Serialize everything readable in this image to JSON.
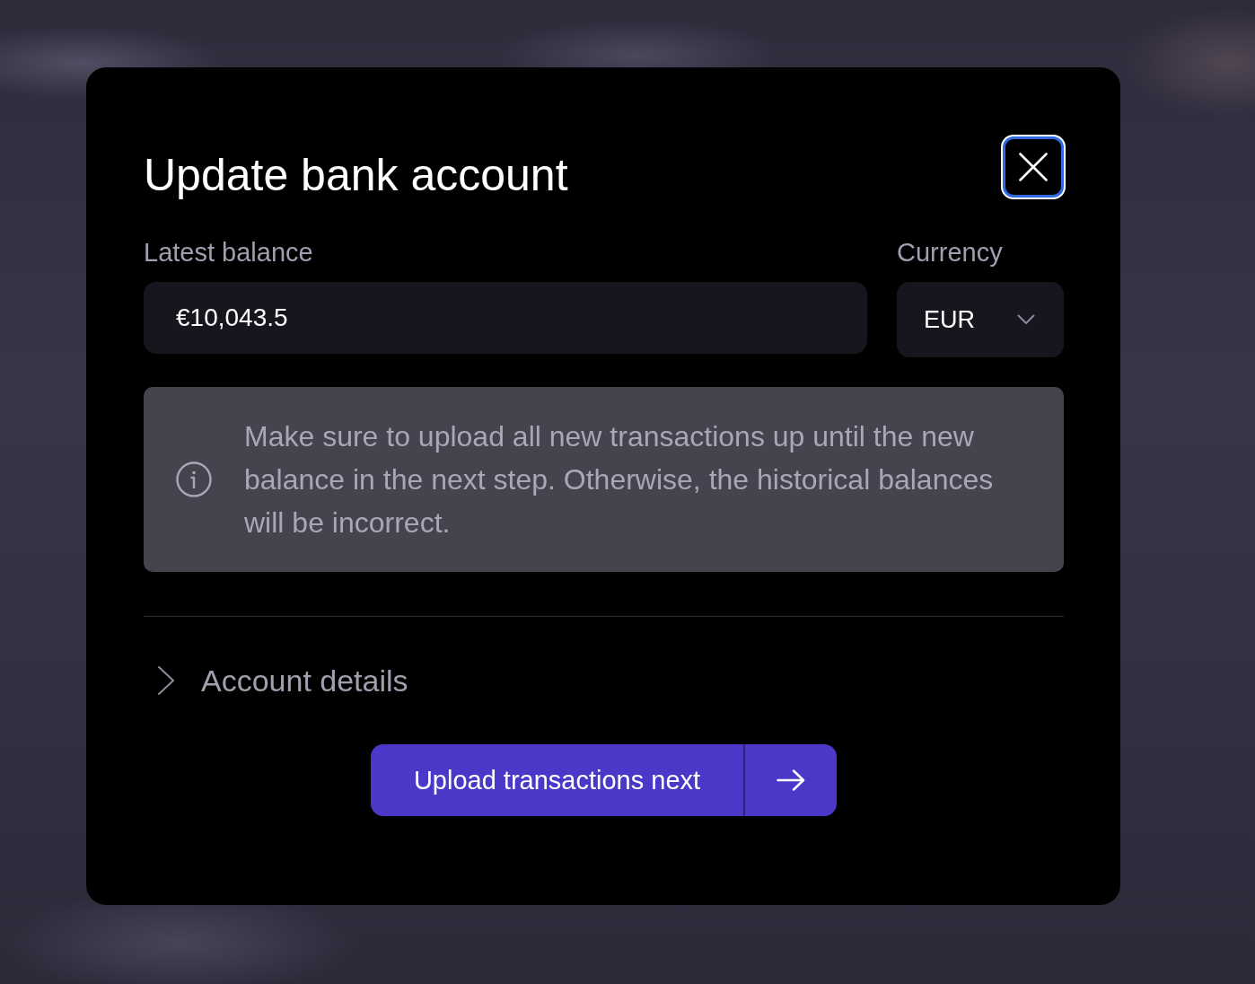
{
  "dialog": {
    "title": "Update bank account",
    "close_button": {
      "focused": true
    }
  },
  "balance_field": {
    "label": "Latest balance",
    "value": "€10,043.5"
  },
  "currency_field": {
    "label": "Currency",
    "value": "EUR"
  },
  "notice": {
    "text": "Make sure to upload all new transactions up until the new balance in the next step. Otherwise, the historical balances will be incorrect."
  },
  "sections": [
    {
      "label": "Account details",
      "expanded": false
    }
  ],
  "primary_button": {
    "label": "Upload transactions next"
  }
}
